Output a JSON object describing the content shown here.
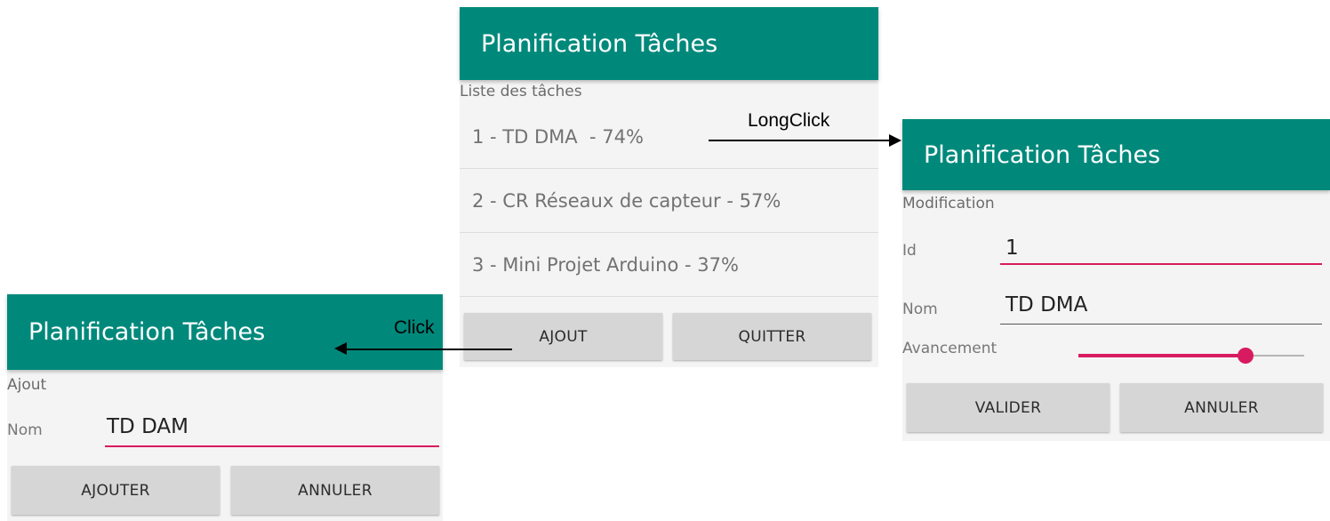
{
  "app_title": "Planification Tâches",
  "main_screen": {
    "section_label": "Liste des tâches",
    "tasks": [
      "1 - TD DMA  - 74%",
      "2 - CR Réseaux de capteur - 57%",
      "3 - Mini Projet Arduino - 37%"
    ],
    "add_button": "AJOUT",
    "quit_button": "QUITTER"
  },
  "edit_screen": {
    "section_label": "Modification",
    "id_label": "Id",
    "id_value": "1",
    "name_label": "Nom",
    "name_value": "TD DMA",
    "progress_label": "Avancement",
    "progress_value": 74,
    "validate_button": "VALIDER",
    "cancel_button": "ANNULER"
  },
  "add_screen": {
    "section_label": "Ajout",
    "name_label": "Nom",
    "name_value": "TD DAM",
    "add_button": "AJOUTER",
    "cancel_button": "ANNULER"
  },
  "annotations": {
    "longclick": "LongClick",
    "click": "Click"
  },
  "colors": {
    "appbar": "#00897b",
    "accent": "#d81b60",
    "button": "#d6d6d6"
  }
}
